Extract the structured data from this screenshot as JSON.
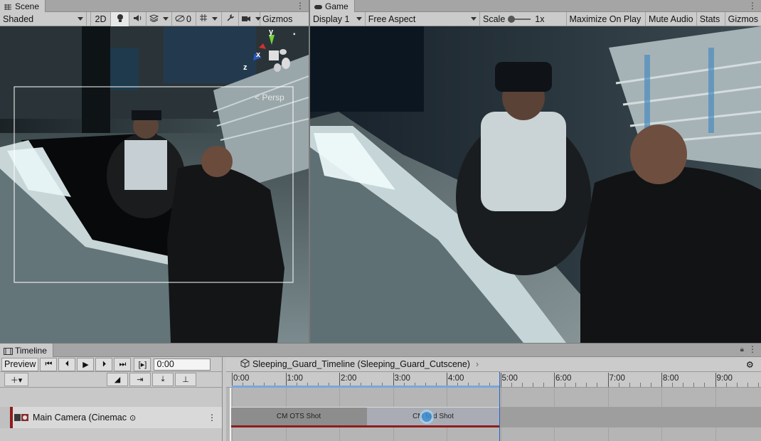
{
  "scene": {
    "tab_label": "Scene",
    "shading_mode": "Shaded",
    "mode_2d": "2D",
    "hidden_count": "0",
    "gizmos_label": "Gizmos",
    "persp_label": "Persp",
    "axis_y": "y",
    "axis_x": "x",
    "axis_z": "z"
  },
  "game": {
    "tab_label": "Game",
    "display": "Display 1",
    "aspect": "Free Aspect",
    "scale_label": "Scale",
    "scale_value": "1x",
    "maximize": "Maximize On Play",
    "mute": "Mute Audio",
    "stats": "Stats",
    "gizmos_label": "Gizmos"
  },
  "timeline": {
    "tab_label": "Timeline",
    "preview": "Preview",
    "time_value": "0:00",
    "breadcrumb": "Sleeping_Guard_Timeline (Sleeping_Guard_Cutscene)",
    "track_name": "Main Camera (Cinemac",
    "ruler_ticks": [
      "0:00",
      "1:00",
      "2:00",
      "3:00",
      "4:00",
      "5:00",
      "6:00",
      "7:00",
      "8:00",
      "9:00"
    ],
    "clips": [
      {
        "label": "CM OTS Shot"
      },
      {
        "label": "CM Mid Shot"
      }
    ],
    "playhead_label": "5:00"
  },
  "colors": {
    "panel_bg": "#c8c8c8",
    "track_accent": "#8f1c1c",
    "playhead": "#2b63c6"
  }
}
